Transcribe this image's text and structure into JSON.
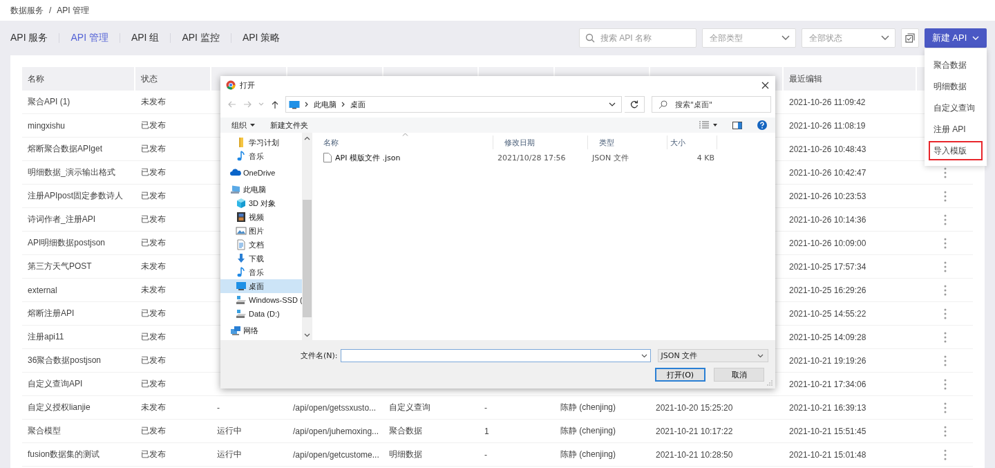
{
  "breadcrumb": {
    "items": [
      "数据服务",
      "API 管理"
    ],
    "separator": "/"
  },
  "tabs": [
    {
      "label": "API 服务",
      "selected": false
    },
    {
      "label": "API 管理",
      "selected": true
    },
    {
      "label": "API 组",
      "selected": false
    },
    {
      "label": "API 监控",
      "selected": false
    },
    {
      "label": "API 策略",
      "selected": false
    }
  ],
  "toolbar": {
    "search": {
      "placeholder": "搜索 API 名称"
    },
    "type_filter": "全部类型",
    "status_filter": "全部状态",
    "new_button": "新建 API"
  },
  "new_menu": [
    {
      "label": "聚合数据",
      "highlighted": false
    },
    {
      "label": "明细数据",
      "highlighted": false
    },
    {
      "label": "自定义查询",
      "highlighted": false
    },
    {
      "label": "注册 API",
      "highlighted": false
    },
    {
      "label": "导入模版",
      "highlighted": true
    }
  ],
  "table": {
    "columns": [
      "名称",
      "状态",
      null,
      null,
      null,
      null,
      null,
      null,
      "最近编辑"
    ],
    "rows": [
      {
        "cells": [
          "聚合API (1)",
          "未发布",
          null,
          null,
          null,
          null,
          null,
          null,
          "2021-10-26 11:09:42"
        ]
      },
      {
        "cells": [
          "mingxishu",
          "已发布",
          null,
          null,
          null,
          null,
          null,
          null,
          "2021-10-26 11:08:19"
        ]
      },
      {
        "cells": [
          "熔断聚合数据APIget",
          "已发布",
          null,
          null,
          null,
          null,
          null,
          null,
          "2021-10-26 10:48:43"
        ]
      },
      {
        "cells": [
          "明细数据_演示输出格式",
          "已发布",
          null,
          null,
          null,
          null,
          null,
          null,
          "2021-10-26 10:42:47"
        ],
        "more_menu": true
      },
      {
        "cells": [
          "注册APIpost固定参数诗人",
          "已发布",
          null,
          null,
          null,
          null,
          null,
          null,
          "2021-10-26 10:23:53"
        ],
        "more_menu": true
      },
      {
        "cells": [
          "诗词作者_注册API",
          "已发布",
          null,
          null,
          null,
          null,
          null,
          null,
          "2021-10-26 10:14:36"
        ],
        "more_menu": true
      },
      {
        "cells": [
          "API明细数据postjson",
          "已发布",
          null,
          null,
          null,
          null,
          null,
          null,
          "2021-10-26 10:09:00"
        ],
        "more_menu": true
      },
      {
        "cells": [
          "第三方天气POST",
          "未发布",
          null,
          null,
          null,
          null,
          null,
          null,
          "2021-10-25 17:57:34"
        ],
        "more_menu": true
      },
      {
        "cells": [
          "external",
          "未发布",
          null,
          null,
          null,
          null,
          null,
          null,
          "2021-10-25 16:29:26"
        ],
        "more_menu": true
      },
      {
        "cells": [
          "熔断注册API",
          "已发布",
          null,
          null,
          null,
          null,
          null,
          null,
          "2021-10-25 14:55:22"
        ],
        "more_menu": true
      },
      {
        "cells": [
          "注册api11",
          "已发布",
          null,
          null,
          null,
          null,
          null,
          null,
          "2021-10-25 14:09:28"
        ],
        "more_menu": true
      },
      {
        "cells": [
          "36聚合数据postjson",
          "已发布",
          null,
          null,
          null,
          null,
          null,
          null,
          "2021-10-21 19:19:26"
        ],
        "more_menu": true
      },
      {
        "cells": [
          "自定义查询API",
          "已发布",
          null,
          null,
          null,
          null,
          null,
          null,
          "2021-10-21 17:34:06"
        ],
        "more_menu": true
      },
      {
        "cells": [
          "自定义授权lianjie",
          "未发布",
          "-",
          "/api/open/getssxusto...",
          "自定义查询",
          "-",
          "陈静 (chenjing)",
          "2021-10-20 15:25:20",
          "2021-10-21 16:39:13"
        ],
        "more_menu": true
      },
      {
        "cells": [
          "聚合模型",
          "已发布",
          "运行中",
          "/api/open/juhemoxing...",
          "聚合数据",
          "1",
          "陈静 (chenjing)",
          "2021-10-21 10:17:22",
          "2021-10-21 15:51:45"
        ],
        "more_menu": true
      },
      {
        "cells": [
          "fusion数据集的测试",
          "已发布",
          "运行中",
          "/api/open/getcustome...",
          "明细数据",
          "-",
          "陈静 (chenjing)",
          "2021-10-21 10:28:50",
          "2021-10-21 15:01:48"
        ],
        "more_menu": true
      }
    ]
  },
  "dialog": {
    "title": "打开",
    "path": [
      "此电脑",
      "桌面"
    ],
    "search": {
      "placeholder": "搜索\"桌面\""
    },
    "commands": [
      "组织",
      "新建文件夹"
    ],
    "nav_tree": [
      {
        "label": "学习计划",
        "kind": "folder",
        "selected": false
      },
      {
        "label": "音乐",
        "kind": "music",
        "selected": false
      }
    ],
    "nav_roots": [
      {
        "label": "OneDrive",
        "kind": "cloud",
        "selected": false
      },
      {
        "label": "此电脑",
        "kind": "pc",
        "selected": false,
        "children": [
          {
            "label": "3D 对象",
            "kind": "cube",
            "selected": false
          },
          {
            "label": "视频",
            "kind": "film",
            "selected": false
          },
          {
            "label": "图片",
            "kind": "image",
            "selected": false
          },
          {
            "label": "文档",
            "kind": "doc",
            "selected": false
          },
          {
            "label": "下载",
            "kind": "download",
            "selected": false
          },
          {
            "label": "音乐",
            "kind": "music",
            "selected": false
          },
          {
            "label": "桌面",
            "kind": "desktop",
            "selected": true
          },
          {
            "label": "Windows-SSD (",
            "kind": "drive",
            "selected": false
          },
          {
            "label": "Data (D:)",
            "kind": "drive",
            "selected": false
          }
        ]
      },
      {
        "label": "网络",
        "kind": "network",
        "selected": false
      }
    ],
    "columns": [
      "名称",
      "修改日期",
      "类型",
      "大小"
    ],
    "files": [
      {
        "name": "API 模版文件 .json",
        "modified": "2021/10/28 17:56",
        "type": "JSON 文件",
        "size": "4 KB"
      }
    ],
    "filename_label": "文件名(N):",
    "file_type": "JSON 文件",
    "buttons": [
      "打开(O)",
      "取消"
    ]
  }
}
